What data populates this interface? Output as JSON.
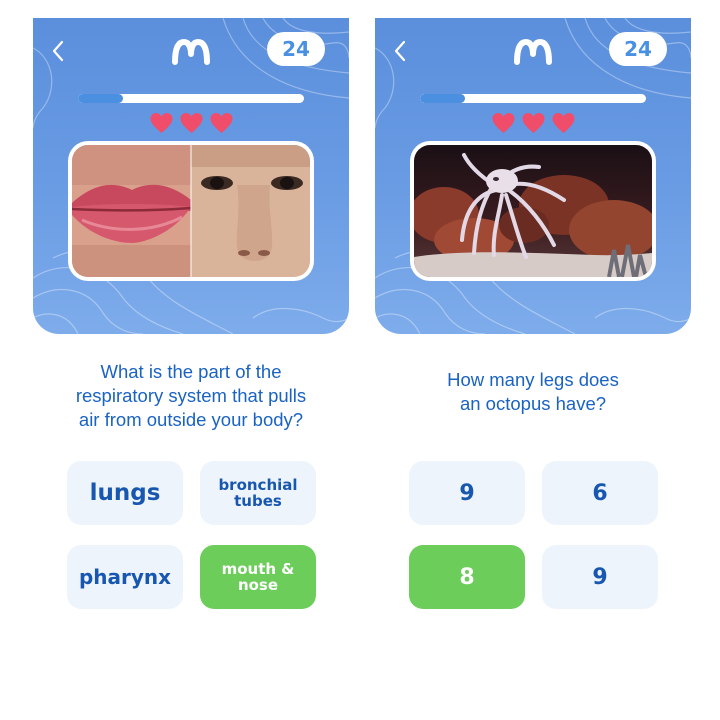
{
  "screens": [
    {
      "score": "24",
      "progress": 0.2,
      "hearts": 3,
      "image_alt": "lips and nose photo",
      "question": "What  is the part of the\nrespiratory system that pulls\nair from outside your body?",
      "answers": [
        {
          "label": "lungs",
          "state": "default"
        },
        {
          "label": "bronchial\ntubes",
          "state": "default"
        },
        {
          "label": "pharynx",
          "state": "default"
        },
        {
          "label": "mouth &\nnose",
          "state": "correct"
        }
      ]
    },
    {
      "score": "24",
      "progress": 0.2,
      "hearts": 3,
      "image_alt": "octopus in aquarium photo",
      "question": "How many legs does\nan octopus have?",
      "answers": [
        {
          "label": "9",
          "state": "default"
        },
        {
          "label": "6",
          "state": "default"
        },
        {
          "label": "8",
          "state": "correct"
        },
        {
          "label": "9",
          "state": "default"
        }
      ]
    }
  ],
  "colors": {
    "header_blue": "#5b8fdc",
    "accent_blue": "#4a90e2",
    "text_blue": "#1a63c2",
    "heart_red": "#ef4d6a",
    "correct_green": "#6ccd5b",
    "answer_bg": "#eef4fc"
  }
}
